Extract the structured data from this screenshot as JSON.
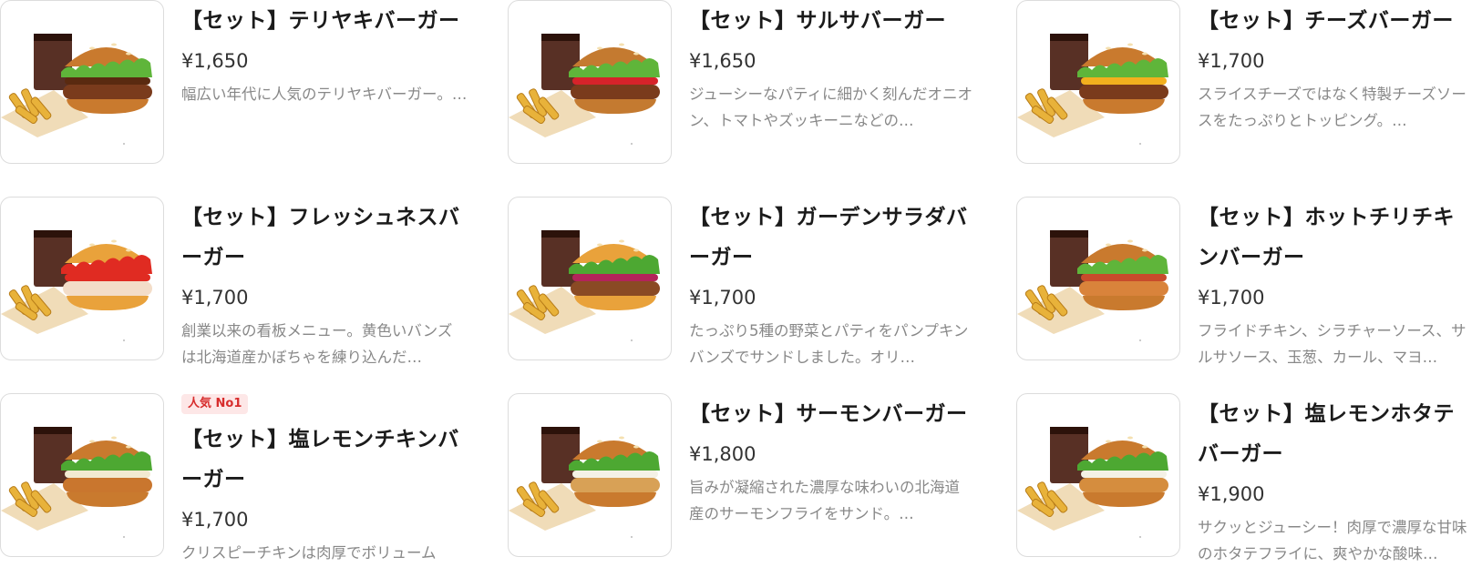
{
  "menu": {
    "items": [
      {
        "name": "【セット】テリヤキバーガー",
        "price": "¥1,650",
        "description": "幅広い年代に人気のテリヤキバーガー。…",
        "badge": "",
        "bun": "#c97a2e",
        "filling": "#7a3b1c",
        "sauce": "#5a2a10",
        "veg": "#5fb53a"
      },
      {
        "name": "【セット】サルサバーガー",
        "price": "¥1,650",
        "description": "ジューシーなパティに細かく刻んだオニオン、トマトやズッキーニなどの…",
        "badge": "",
        "bun": "#c47a30",
        "filling": "#7a3b1c",
        "sauce": "#d6232a",
        "veg": "#5fb53a"
      },
      {
        "name": "【セット】チーズバーガー",
        "price": "¥1,700",
        "description": "スライスチーズではなく特製チーズソースをたっぷりとトッピング。…",
        "badge": "",
        "bun": "#c97a2e",
        "filling": "#7a3b1c",
        "sauce": "#f2b01e",
        "veg": "#5fb53a"
      },
      {
        "name": "【セット】フレッシュネスバーガー",
        "price": "¥1,700",
        "description": "創業以来の看板メニュー。黄色いバンズは北海道産かぼちゃを練り込んだ…",
        "badge": "",
        "bun": "#e9a23b",
        "filling": "#f3ddc8",
        "sauce": "#e02b22",
        "veg": "#e02b22"
      },
      {
        "name": "【セット】ガーデンサラダバーガー",
        "price": "¥1,700",
        "description": "たっぷり5種の野菜とパティをパンプキンバンズでサンドしました。オリ…",
        "badge": "",
        "bun": "#e9a23b",
        "filling": "#8a4a24",
        "sauce": "#b3245a",
        "veg": "#4da832"
      },
      {
        "name": "【セット】ホットチリチキンバーガー",
        "price": "¥1,700",
        "description": "フライドチキン、シラチャーソース、サルサソース、玉葱、カール、マヨ…",
        "badge": "",
        "bun": "#c97a2e",
        "filling": "#d9833b",
        "sauce": "#c84b2b",
        "veg": "#5fb53a"
      },
      {
        "name": "【セット】塩レモンチキンバーガー",
        "price": "¥1,700",
        "description": "クリスピーチキンは肉厚でボリューム",
        "badge": "人気 No1",
        "bun": "#c97a2e",
        "filling": "#c9762e",
        "sauce": "#f2ead2",
        "veg": "#4da832"
      },
      {
        "name": "【セット】サーモンバーガー",
        "price": "¥1,800",
        "description": "旨みが凝縮された濃厚な味わいの北海道産のサーモンフライをサンド。…",
        "badge": "",
        "bun": "#c97a2e",
        "filling": "#d8a156",
        "sauce": "#f4f1e6",
        "veg": "#4da832"
      },
      {
        "name": "【セット】塩レモンホタテバーガー",
        "price": "¥1,900",
        "description": "サクッとジューシー！肉厚で濃厚な甘味のホタテフライに、爽やかな酸味…",
        "badge": "",
        "bun": "#c97a2e",
        "filling": "#d58d3e",
        "sauce": "#f4f1e6",
        "veg": "#4da832"
      }
    ]
  }
}
